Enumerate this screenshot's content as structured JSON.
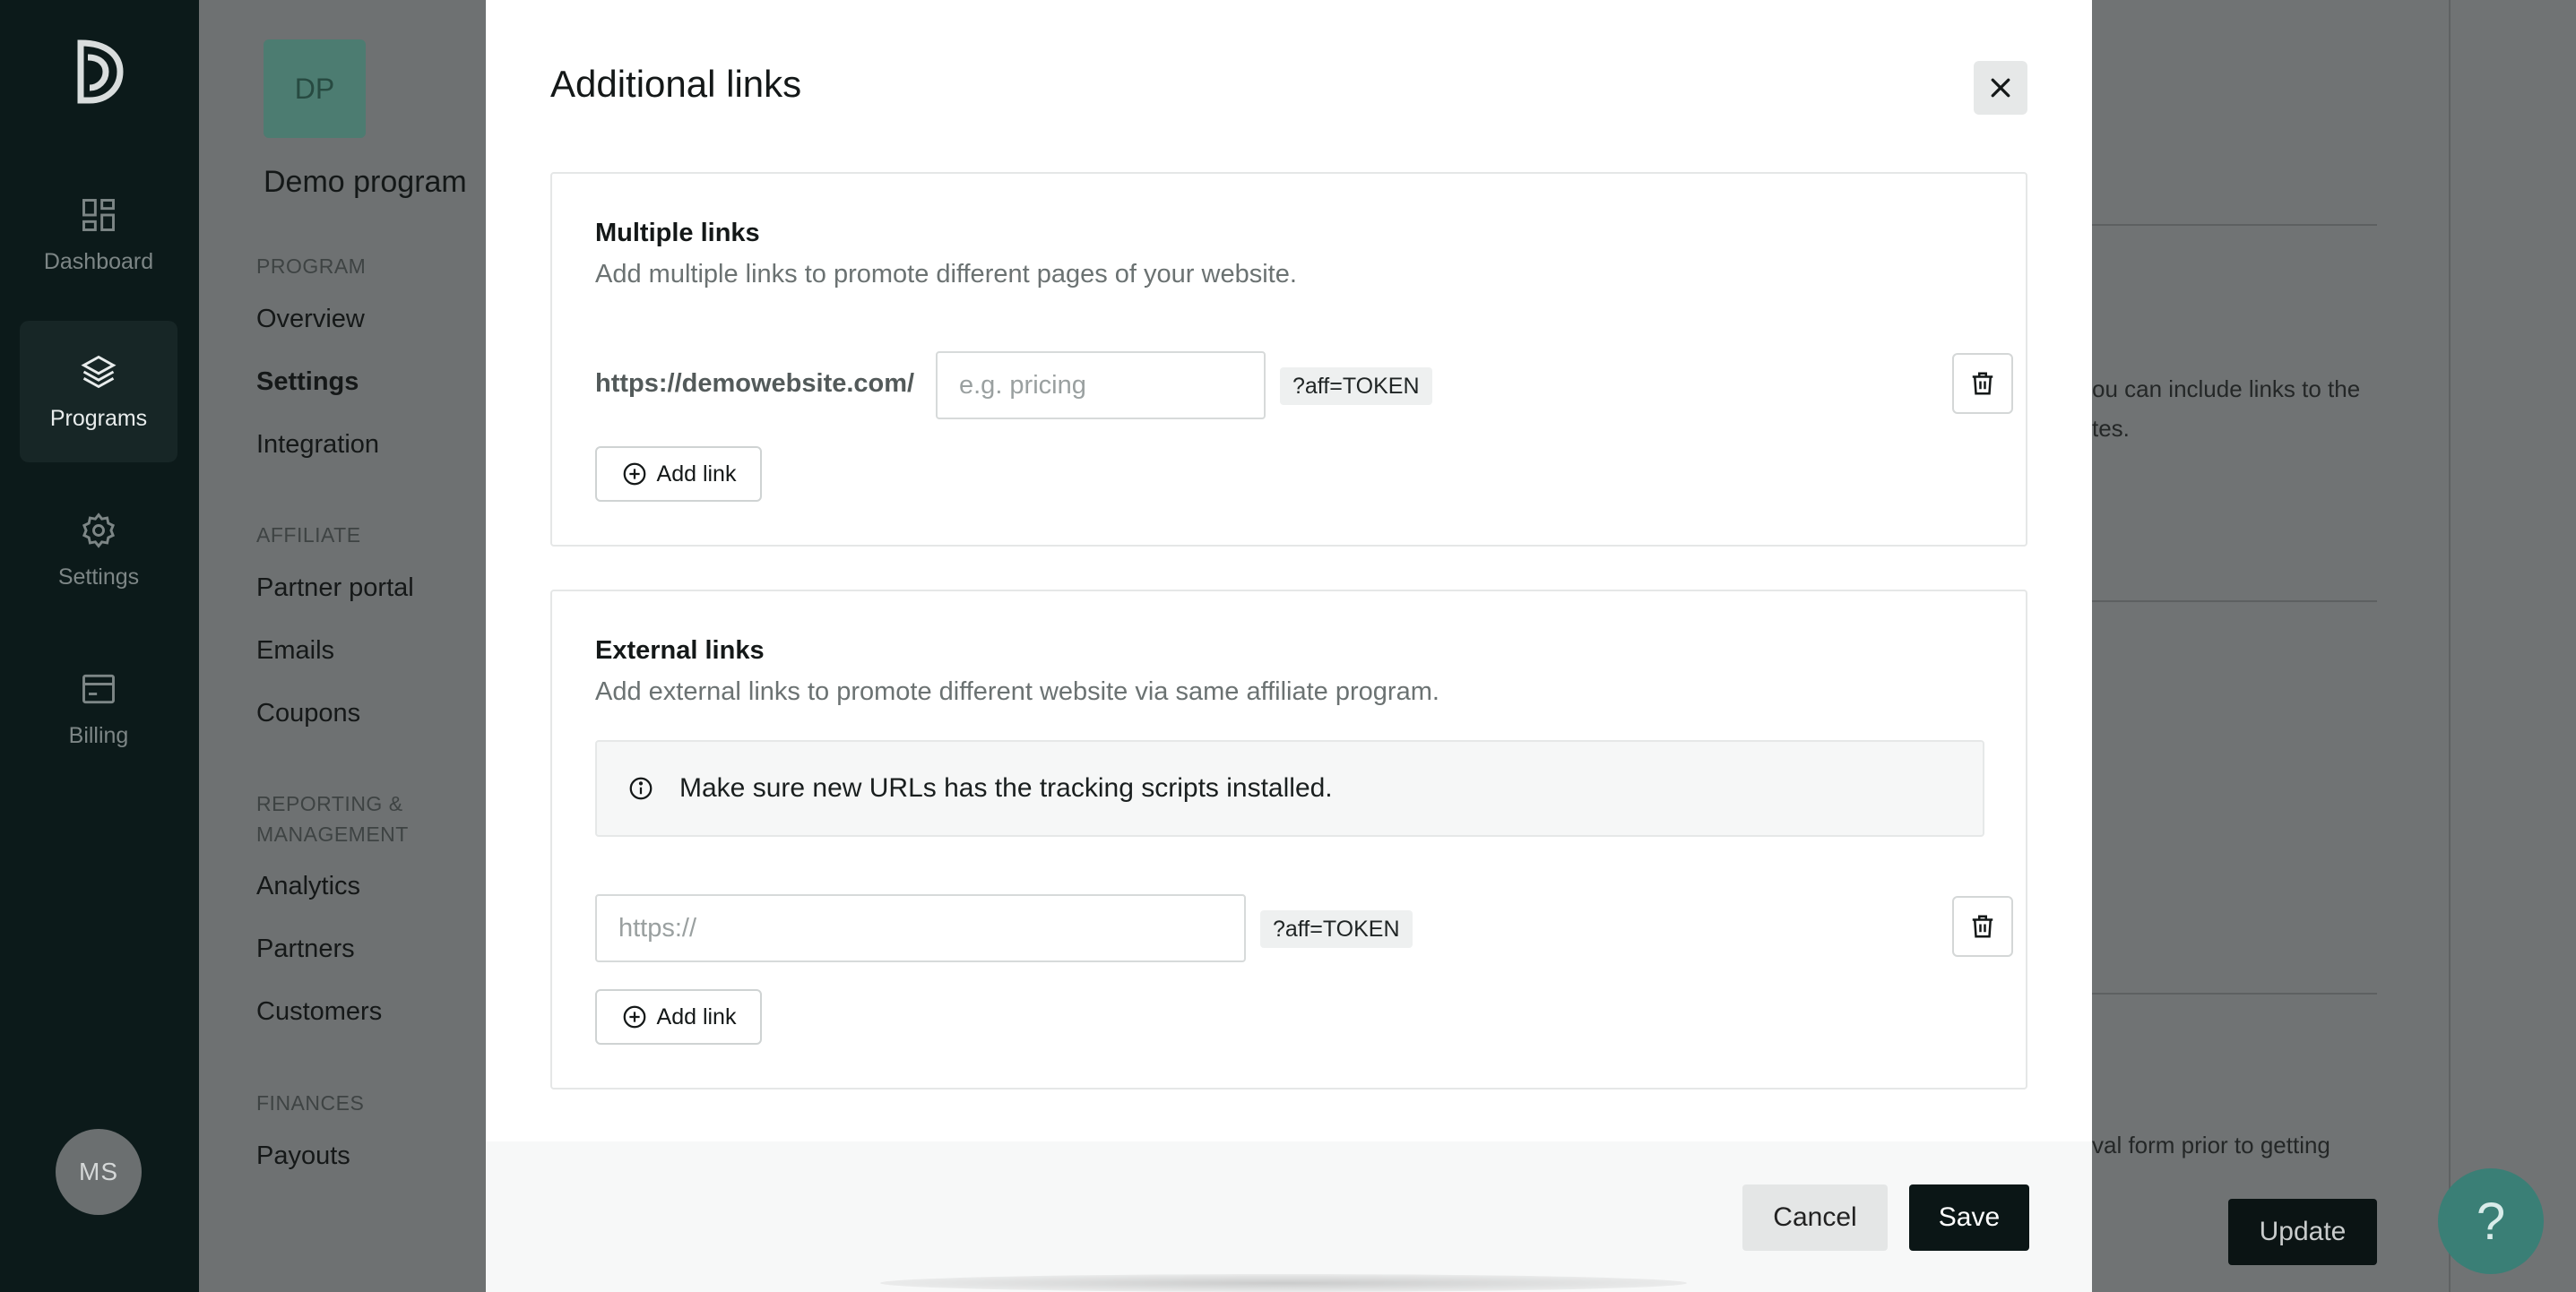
{
  "sidebar": {
    "items": [
      {
        "label": "Dashboard",
        "icon": "dashboard-icon"
      },
      {
        "label": "Programs",
        "icon": "layers-icon",
        "active": true
      },
      {
        "label": "Settings",
        "icon": "gear-icon"
      },
      {
        "label": "Billing",
        "icon": "billing-icon"
      }
    ],
    "user_initials": "MS"
  },
  "program": {
    "initials": "DP",
    "name": "Demo program"
  },
  "subnav": {
    "sections": [
      {
        "title": "PROGRAM",
        "links": [
          "Overview",
          "Settings",
          "Integration"
        ]
      },
      {
        "title": "AFFILIATE",
        "links": [
          "Partner portal",
          "Emails",
          "Coupons"
        ]
      },
      {
        "title": "REPORTING & MANAGEMENT",
        "links": [
          "Analytics",
          "Partners",
          "Customers"
        ]
      },
      {
        "title": "FINANCES",
        "links": [
          "Payouts"
        ]
      }
    ],
    "active": "Settings"
  },
  "background": {
    "text_fragments": [
      "ou can include links to the",
      "tes.",
      "val form prior to getting"
    ],
    "update_label": "Update",
    "help_label": "?"
  },
  "modal": {
    "title": "Additional links",
    "multiple_links": {
      "title": "Multiple links",
      "description": "Add multiple links to promote different pages of your website.",
      "url_prefix": "https://demowebsite.com/",
      "input_placeholder": "e.g. pricing",
      "input_value": "",
      "token": "?aff=TOKEN",
      "add_label": "Add link"
    },
    "external_links": {
      "title": "External links",
      "description": "Add external links to promote different website via same affiliate program.",
      "info": "Make sure new URLs has the tracking scripts installed.",
      "input_placeholder": "https://",
      "input_value": "",
      "token": "?aff=TOKEN",
      "add_label": "Add link"
    },
    "cancel_label": "Cancel",
    "save_label": "Save"
  },
  "colors": {
    "rail": "#0c1a1a",
    "primary": "#0b1616",
    "help": "#3a7f76"
  }
}
